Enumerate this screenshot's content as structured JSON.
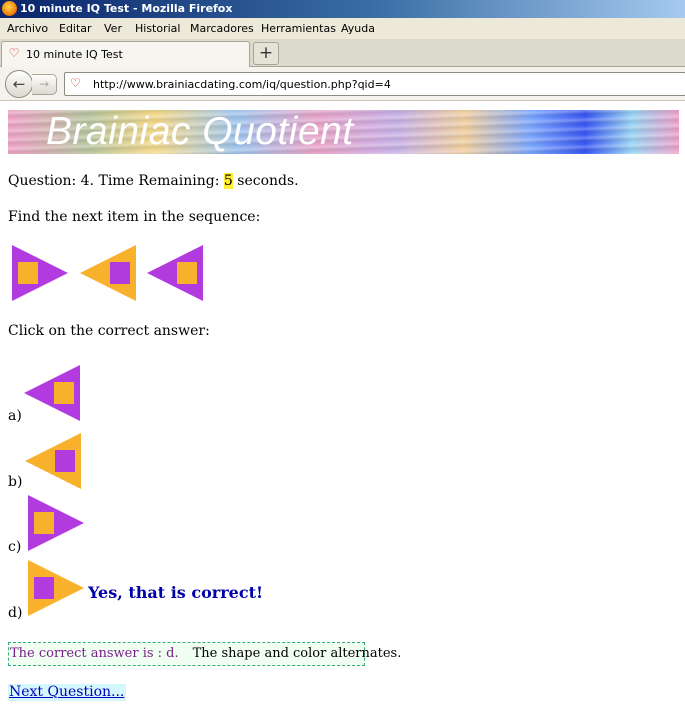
{
  "window": {
    "title": "10 minute IQ Test - Mozilla Firefox"
  },
  "menu": [
    "Archivo",
    "Editar",
    "Ver",
    "Historial",
    "Marcadores",
    "Herramientas",
    "Ayuda"
  ],
  "tab": {
    "label": "10 minute IQ Test",
    "new_tab_icon": "+"
  },
  "nav": {
    "url": "http://www.brainiacdating.com/iq/question.php?qid=4"
  },
  "banner": {
    "title": "Brainiac Quotient"
  },
  "question": {
    "prefix": "Question: 4. Time Remaining: ",
    "seconds": "5",
    "suffix": " seconds.",
    "prompt": "Find the next item in the sequence:",
    "click_prompt": "Click on the correct answer:"
  },
  "sequence": [
    {
      "pointing": "right",
      "triangle": "#b23be0",
      "square": "#f7b12c"
    },
    {
      "pointing": "left",
      "triangle": "#f7b12c",
      "square": "#b23be0"
    },
    {
      "pointing": "left",
      "triangle": "#b23be0",
      "square": "#f7b12c"
    }
  ],
  "options": [
    {
      "label": "a)",
      "pointing": "left",
      "triangle": "#b23be0",
      "square": "#f7b12c"
    },
    {
      "label": "b)",
      "pointing": "left",
      "triangle": "#f7b12c",
      "square": "#b23be0"
    },
    {
      "label": "c)",
      "pointing": "right",
      "triangle": "#b23be0",
      "square": "#f7b12c"
    },
    {
      "label": "d)",
      "pointing": "right",
      "triangle": "#f7b12c",
      "square": "#b23be0"
    }
  ],
  "feedback": {
    "correct": "Yes, that is correct!",
    "answer": "The correct answer is : d.",
    "explanation": "The shape and color alternates."
  },
  "next_link": "Next Question..."
}
